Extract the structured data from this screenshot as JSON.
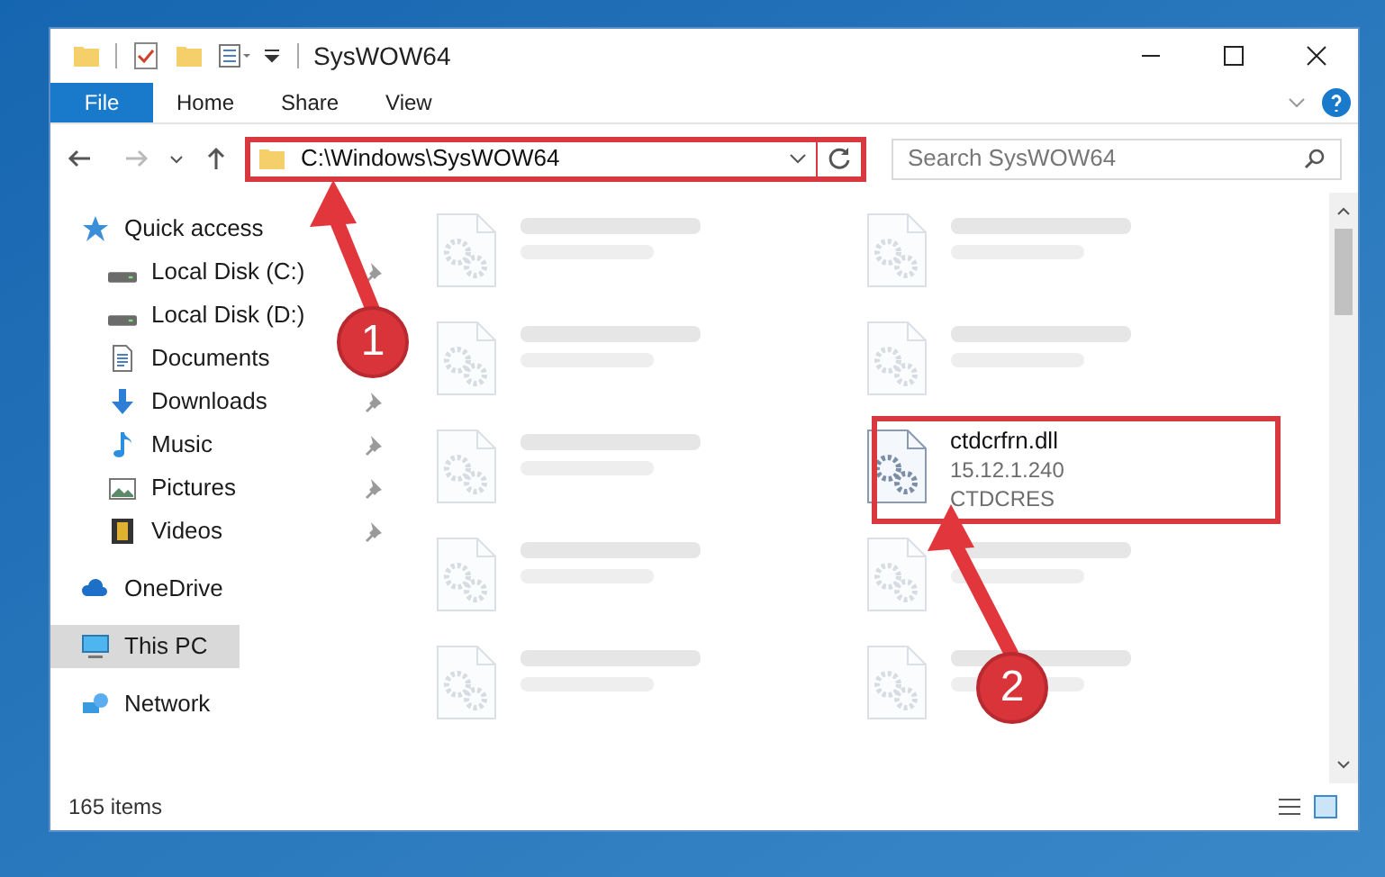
{
  "window": {
    "title": "SysWOW64"
  },
  "ribbon_tabs": [
    {
      "label": "File",
      "kind": "file"
    },
    {
      "label": "Home",
      "kind": "tab"
    },
    {
      "label": "Share",
      "kind": "tab"
    },
    {
      "label": "View",
      "kind": "tab"
    }
  ],
  "address_bar": {
    "path": "C:\\Windows\\SysWOW64"
  },
  "search": {
    "placeholder": "Search SysWOW64"
  },
  "sidebar": {
    "items": [
      {
        "label": "Quick access",
        "kind": "star",
        "selected": false,
        "children": [
          {
            "label": "Local Disk (C:)",
            "kind": "disk",
            "pinned": true
          },
          {
            "label": "Local Disk (D:)",
            "kind": "disk",
            "pinned": false
          },
          {
            "label": "Documents",
            "kind": "doc",
            "pinned": false
          },
          {
            "label": "Downloads",
            "kind": "download",
            "pinned": true
          },
          {
            "label": "Music",
            "kind": "music",
            "pinned": true
          },
          {
            "label": "Pictures",
            "kind": "picture",
            "pinned": true
          },
          {
            "label": "Videos",
            "kind": "video",
            "pinned": true
          }
        ]
      },
      {
        "label": "OneDrive",
        "kind": "cloud",
        "selected": false
      },
      {
        "label": "This PC",
        "kind": "pc",
        "selected": true
      },
      {
        "label": "Network",
        "kind": "network",
        "selected": false
      }
    ]
  },
  "files": [
    {
      "kind": "blurred"
    },
    {
      "kind": "blurred"
    },
    {
      "kind": "blurred"
    },
    {
      "kind": "blurred"
    },
    {
      "kind": "blurred"
    },
    {
      "kind": "file",
      "name": "ctdcrfrn.dll",
      "lines": [
        "15.12.1.240",
        "CTDCRES"
      ]
    },
    {
      "kind": "blurred"
    },
    {
      "kind": "blurred"
    },
    {
      "kind": "blurred"
    },
    {
      "kind": "blurred"
    }
  ],
  "status_bar": {
    "count": "165 items"
  },
  "annotations": [
    {
      "number": "1"
    },
    {
      "number": "2"
    }
  ]
}
